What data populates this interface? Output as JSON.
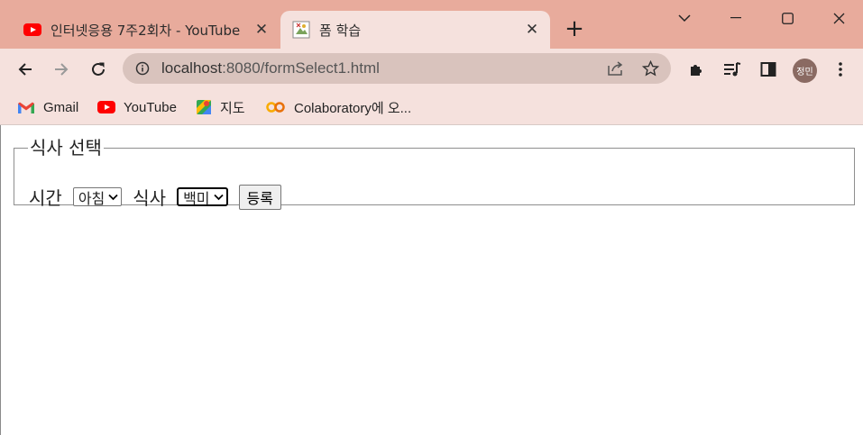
{
  "tabs": [
    {
      "title": "인터넷응용 7주2회차 - YouTube",
      "icon": "youtube-icon",
      "active": false
    },
    {
      "title": "폼 학습",
      "icon": "broken-image-icon",
      "active": true
    }
  ],
  "address_bar": {
    "host": "localhost",
    "rest": ":8080/formSelect1.html"
  },
  "profile": {
    "initials": "정민"
  },
  "bookmarks": [
    {
      "label": "Gmail",
      "icon": "gmail-icon"
    },
    {
      "label": "YouTube",
      "icon": "youtube-icon"
    },
    {
      "label": "지도",
      "icon": "maps-icon"
    },
    {
      "label": "Colaboratory에 오...",
      "icon": "colab-icon"
    }
  ],
  "form": {
    "legend": "식사 선택",
    "time_label": "시간",
    "time_value": "아침",
    "meal_label": "식사",
    "meal_value": "백미",
    "submit_label": "등록"
  },
  "colors": {
    "titlebar": "#e8ab9c",
    "toolbar": "#f5e1dd",
    "omnibox": "#d9c3bd"
  }
}
